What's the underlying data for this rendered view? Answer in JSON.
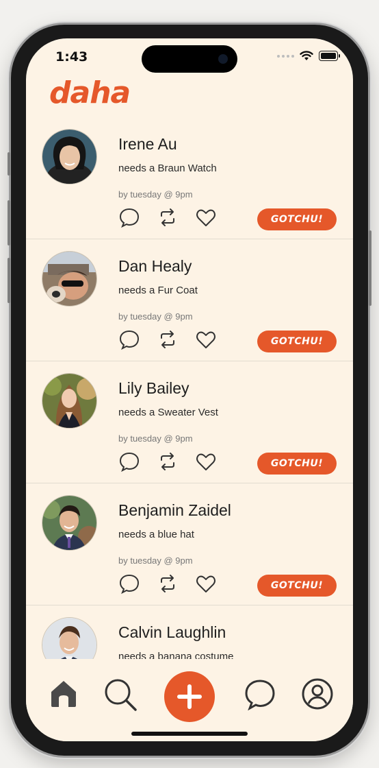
{
  "status_bar": {
    "time": "1:43"
  },
  "app": {
    "logo": "daha",
    "accent": "#e5582a",
    "background": "#fdf3e5"
  },
  "feed": [
    {
      "name": "Irene Au",
      "need": "needs a Braun Watch",
      "due": "by tuesday @ 9pm",
      "action_label": "GOTCHU!"
    },
    {
      "name": "Dan Healy",
      "need": "needs a Fur Coat",
      "due": "by tuesday @ 9pm",
      "action_label": "GOTCHU!"
    },
    {
      "name": "Lily Bailey",
      "need": "needs a Sweater Vest",
      "due": "by tuesday @ 9pm",
      "action_label": "GOTCHU!"
    },
    {
      "name": "Benjamin Zaidel",
      "need": "needs a blue hat",
      "due": "by tuesday @ 9pm",
      "action_label": "GOTCHU!"
    },
    {
      "name": "Calvin Laughlin",
      "need": "needs a banana costume"
    }
  ],
  "tabbar": {
    "items": [
      "home-icon",
      "search-icon",
      "plus-icon",
      "chat-icon",
      "profile-icon"
    ]
  }
}
